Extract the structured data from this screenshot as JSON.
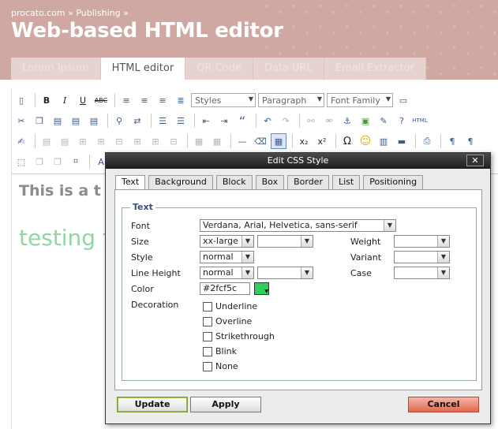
{
  "header": {
    "breadcrumb_site": "procato.com",
    "breadcrumb_sep": "»",
    "breadcrumb_section": "Publishing",
    "breadcrumb_tail": "»",
    "title": "Web-based HTML editor"
  },
  "nav_tabs": [
    {
      "label": "Lorem Ipsum"
    },
    {
      "label": "HTML editor"
    },
    {
      "label": "QR Code"
    },
    {
      "label": "Data URL"
    },
    {
      "label": "Email Extractor"
    }
  ],
  "toolbar": {
    "styles_select": "Styles",
    "format_select": "Paragraph",
    "font_select": "Font Family",
    "strike_label": "ABC",
    "bold_label": "B",
    "italic_label": "I",
    "underline_label": "U",
    "html_label": "HTML",
    "sub_label": "x₂",
    "sup_label": "x²",
    "omega_label": "Ω"
  },
  "editor": {
    "heading_text": "This is a t",
    "body_text": "testing f"
  },
  "dialog": {
    "title": "Edit CSS Style",
    "close_label": "✕",
    "tabs": [
      {
        "label": "Text"
      },
      {
        "label": "Background"
      },
      {
        "label": "Block"
      },
      {
        "label": "Box"
      },
      {
        "label": "Border"
      },
      {
        "label": "List"
      },
      {
        "label": "Positioning"
      }
    ],
    "fieldset_legend": "Text",
    "labels": {
      "font": "Font",
      "size": "Size",
      "style": "Style",
      "line_height": "Line Height",
      "color": "Color",
      "decoration": "Decoration",
      "weight": "Weight",
      "variant": "Variant",
      "case": "Case"
    },
    "values": {
      "font": "Verdana, Arial, Helvetica, sans-serif",
      "size": "xx-large",
      "size_unit": "",
      "style": "normal",
      "line_height": "normal",
      "line_height_unit": "",
      "color": "#2fcf5c",
      "weight": "",
      "variant": "",
      "case": ""
    },
    "decorations": [
      {
        "label": "Underline"
      },
      {
        "label": "Overline"
      },
      {
        "label": "Strikethrough"
      },
      {
        "label": "Blink"
      },
      {
        "label": "None"
      }
    ],
    "buttons": {
      "update": "Update",
      "apply": "Apply",
      "cancel": "Cancel"
    }
  },
  "colors": {
    "header_bg": "#d0a8a3",
    "swatch": "#2fcf5c",
    "cancel_bg": "#e06a50"
  }
}
